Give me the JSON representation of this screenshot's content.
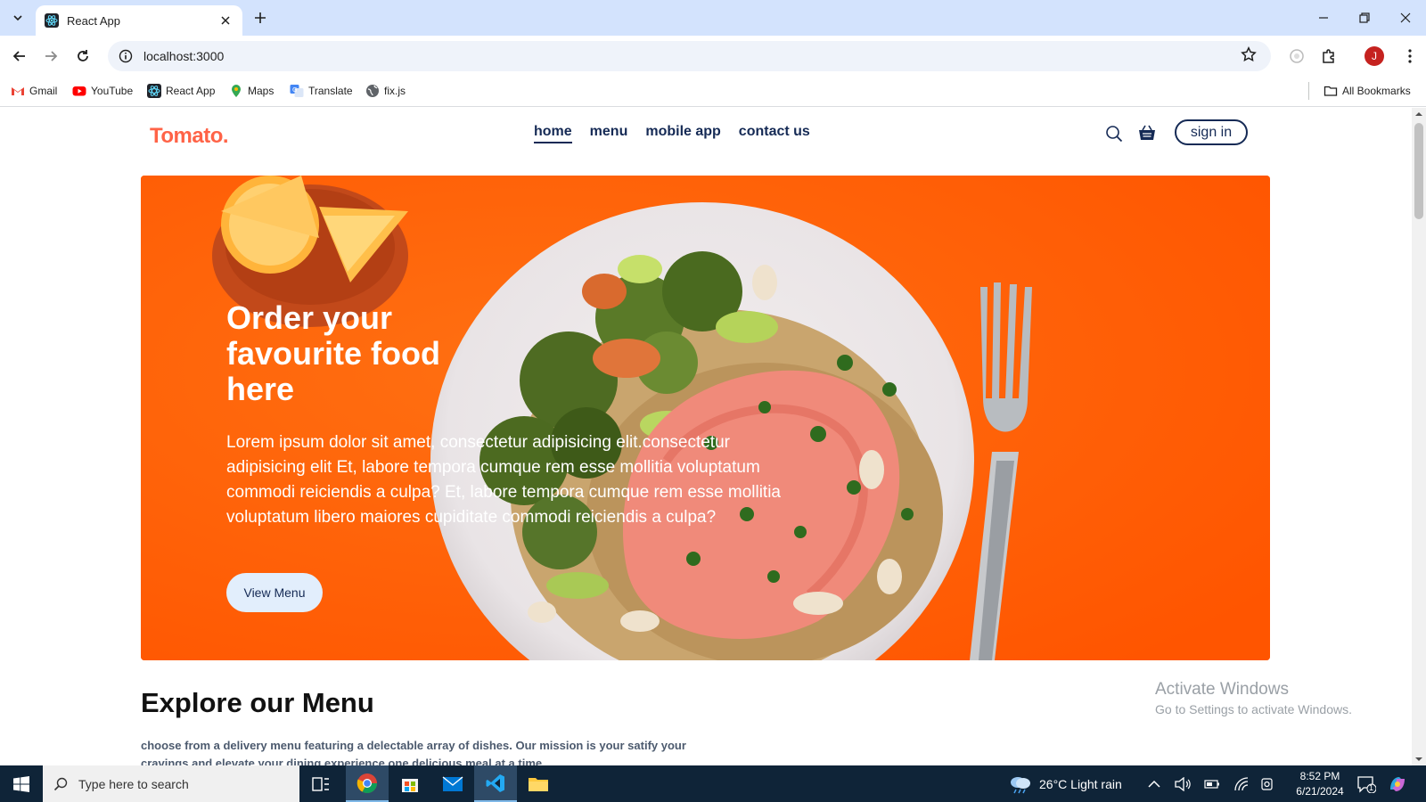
{
  "browser": {
    "tab_title": "React App",
    "url": "localhost:3000",
    "profile_initial": "J",
    "bookmarks": [
      {
        "label": "Gmail",
        "icon": "gmail-icon"
      },
      {
        "label": "YouTube",
        "icon": "youtube-icon"
      },
      {
        "label": "React App",
        "icon": "react-icon"
      },
      {
        "label": "Maps",
        "icon": "maps-icon"
      },
      {
        "label": "Translate",
        "icon": "translate-icon"
      },
      {
        "label": "fix.js",
        "icon": "globe-icon"
      }
    ],
    "all_bookmarks": "All Bookmarks"
  },
  "site": {
    "logo": "Tomato.",
    "nav": [
      "home",
      "menu",
      "mobile app",
      "contact us"
    ],
    "active_nav": "home",
    "sign_in": "sign in",
    "accent": "#ff6347",
    "navy": "#152a55"
  },
  "hero": {
    "title": "Order your favourite food here",
    "text": "Lorem ipsum dolor sit amet, consectetur adipisicing elit.consectetur adipisicing elit Et, labore tempora cumque rem esse mollitia voluptatum commodi reiciendis a culpa? Et, labore tempora cumque rem esse mollitia voluptatum libero maiores cupiditate commodi reiciendis a culpa?",
    "button": "View Menu"
  },
  "explore": {
    "title": "Explore our Menu",
    "text": "choose from a delivery menu featuring a delectable array of dishes. Our mission is your satify your cravings and elevate your dining experience,one delicious meal at a time."
  },
  "watermark": {
    "line1": "Activate Windows",
    "line2": "Go to Settings to activate Windows."
  },
  "taskbar": {
    "search_placeholder": "Type here to search",
    "weather": "26°C  Light rain",
    "time": "8:52 PM",
    "date": "6/21/2024",
    "notifications": "1"
  }
}
